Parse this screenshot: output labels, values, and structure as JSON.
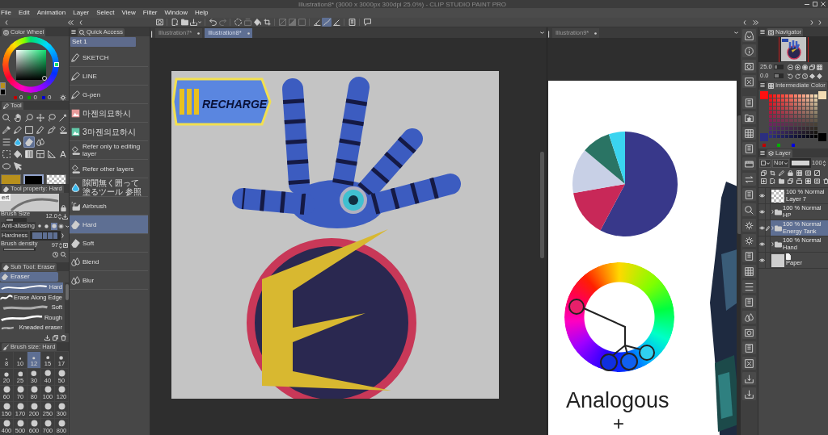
{
  "window": {
    "title": "Illustration8* (3000 x 3000px 300dpi 25.0%) - CLIP STUDIO PAINT PRO"
  },
  "menu": [
    "File",
    "Edit",
    "Animation",
    "Layer",
    "Select",
    "View",
    "Filter",
    "Window",
    "Help"
  ],
  "command_bar": [
    {
      "on": false,
      "disabled": false
    },
    {
      "on": false,
      "disabled": false
    },
    {
      "on": false,
      "disabled": false
    },
    {
      "on": false,
      "disabled": false
    },
    {
      "on": false,
      "disabled": false
    },
    {
      "on": false,
      "disabled": true
    },
    {
      "on": false,
      "disabled": false
    },
    {
      "on": false,
      "disabled": true
    },
    {
      "on": false,
      "disabled": false
    },
    {
      "on": false,
      "disabled": false
    },
    {
      "on": false,
      "disabled": true
    },
    {
      "on": false,
      "disabled": true
    },
    {
      "on": false,
      "disabled": true
    },
    {
      "on": false,
      "disabled": false
    },
    {
      "on": true,
      "disabled": false
    },
    {
      "on": false,
      "disabled": false
    },
    {
      "on": false,
      "disabled": false
    },
    {
      "on": false,
      "disabled": false
    }
  ],
  "color_wheel": {
    "title": "Color Wheel",
    "colors": [
      {
        "color": "#b8901c"
      },
      {
        "color": "#000000"
      }
    ],
    "channels": [
      {
        "color": "#c00000",
        "value": "0"
      },
      {
        "color": "#00a000",
        "value": "0"
      },
      {
        "color": "#0000d0",
        "value": "0"
      }
    ]
  },
  "tool_panel": {
    "title": "Tool",
    "tool_rows": [
      [
        {
          "selected": false
        },
        {
          "selected": false
        },
        {
          "selected": false
        },
        {
          "selected": false
        },
        {
          "selected": false
        },
        {
          "selected": false
        }
      ],
      [
        {
          "selected": false
        },
        {
          "selected": false
        },
        {
          "selected": false
        },
        {
          "selected": false
        },
        {
          "selected": false
        },
        {
          "selected": false
        }
      ],
      [
        {
          "selected": false
        },
        {
          "selected": false
        },
        {
          "selected": true
        },
        {
          "selected": false
        }
      ],
      [
        {
          "selected": false
        },
        {
          "selected": false
        },
        {
          "selected": false
        },
        {
          "selected": false
        },
        {
          "selected": false
        },
        {
          "glyph": "A",
          "selected": false
        }
      ],
      [
        {
          "selected": false
        },
        {
          "selected": false
        }
      ]
    ],
    "colors": [
      {
        "kind": "solid",
        "color": "#b8901c",
        "selected": false
      },
      {
        "kind": "solid",
        "color": "#000000",
        "selected": true
      },
      {
        "kind": "transparent",
        "selected": false
      }
    ]
  },
  "tool_property": {
    "title": "Tool property: Hard",
    "preview_label": "ert",
    "brush_size": {
      "label": "Brush Size",
      "value": "12.0",
      "level": 0.35
    },
    "anti_aliasing": {
      "label": "Anti-aliasing",
      "options": [
        {
          "selected": false
        },
        {
          "selected": false
        },
        {
          "selected": true
        },
        {
          "selected": false
        }
      ]
    },
    "hardness": {
      "label": "Hardness",
      "level": 1
    },
    "brush_density": {
      "label": "Brush density",
      "value": "97",
      "level": 0.97
    }
  },
  "sub_tool": {
    "title": "Sub Tool: Eraser",
    "group": {
      "label": "Eraser",
      "selected": true
    },
    "items": [
      {
        "label": "Hard",
        "selected": true
      },
      {
        "label": "Erase Along Edge",
        "selected": false
      },
      {
        "label": "Soft",
        "selected": false
      },
      {
        "label": "Rough",
        "selected": false
      },
      {
        "label": "Kneaded eraser",
        "selected": false
      }
    ]
  },
  "brush_size_panel": {
    "title": "Brush size: Hard",
    "sizes": [
      {
        "label": "8",
        "selected": false
      },
      {
        "label": "10",
        "selected": false
      },
      {
        "label": "12",
        "selected": true
      },
      {
        "label": "15",
        "selected": false
      },
      {
        "label": "17",
        "selected": false
      },
      {
        "label": "20",
        "selected": false
      },
      {
        "label": "25",
        "selected": false
      },
      {
        "label": "30",
        "selected": false
      },
      {
        "label": "40",
        "selected": false
      },
      {
        "label": "50",
        "selected": false
      },
      {
        "label": "60",
        "selected": false
      },
      {
        "label": "70",
        "selected": false
      },
      {
        "label": "80",
        "selected": false
      },
      {
        "label": "100",
        "selected": false
      },
      {
        "label": "120",
        "selected": false
      },
      {
        "label": "150",
        "selected": false
      },
      {
        "label": "170",
        "selected": false
      },
      {
        "label": "200",
        "selected": false
      },
      {
        "label": "250",
        "selected": false
      },
      {
        "label": "300",
        "selected": false
      },
      {
        "label": "400",
        "selected": false
      },
      {
        "label": "500",
        "selected": false
      },
      {
        "label": "600",
        "selected": false
      },
      {
        "label": "700",
        "selected": false
      },
      {
        "label": "800",
        "selected": false
      }
    ]
  },
  "quick_access": {
    "title": "Quick Access",
    "set": "Set 1",
    "items": [
      {
        "label": "SKETCH",
        "selected": false
      },
      {
        "label": "LINE",
        "selected": false
      },
      {
        "label": "G-pen",
        "selected": false
      },
      {
        "label": "마젠의묘하시",
        "selected": false
      },
      {
        "label": "3마젠의묘하시",
        "selected": false
      },
      {
        "label": "Refer only to editing layer",
        "selected": false
      },
      {
        "label": "Refer other layers",
        "selected": false
      },
      {
        "label": "隙間無く囲って塗るツール 参照",
        "selected": false
      },
      {
        "label": "Airbrush",
        "selected": false
      },
      {
        "label": "Hard",
        "selected": true
      },
      {
        "label": "Soft",
        "selected": false
      },
      {
        "label": "Blend",
        "selected": false
      },
      {
        "label": "Blur",
        "selected": false
      }
    ]
  },
  "canvases": [
    {
      "tabs": [
        {
          "label": "Illustration7*",
          "selected": false
        },
        {
          "label": "Illustration8*",
          "selected": true
        }
      ],
      "logo_text": "RECHARGE"
    },
    {
      "tabs": [
        {
          "label": "Illustration9*",
          "selected": false
        }
      ],
      "texts": [
        "Analogous",
        "+"
      ]
    }
  ],
  "navigator": {
    "title": "Navigator",
    "zoom": "25.0",
    "zoom_slider": {
      "level": 0.25
    },
    "rotation": "0.0",
    "rotation_slider": {
      "level": 0.5
    }
  },
  "intermediate_color": {
    "title": "Intermediate Color",
    "corners": [
      {
        "color": "#ff1010"
      },
      {
        "color": "#f2dcb4"
      },
      {
        "color": "#2c2f80"
      },
      {
        "color": "#000000"
      }
    ],
    "channels": [
      {
        "color": "#c00000"
      },
      {
        "color": "#00b000"
      },
      {
        "color": "#0000e0"
      }
    ]
  },
  "layer_panel": {
    "title": "Layer",
    "blend_mode": "Nor",
    "opacity": "100",
    "opacity_slider": {
      "level": 1
    },
    "layers": [
      {
        "name": "Layer 7",
        "mode": "100 % Normal",
        "kind": "raster",
        "visible": true,
        "selected": false
      },
      {
        "name": "HP",
        "mode": "100 % Normal",
        "kind": "folder",
        "visible": true,
        "selected": false,
        "expanded": false
      },
      {
        "name": "Energy Tank",
        "mode": "100 % Normal",
        "kind": "folder",
        "visible": true,
        "selected": true,
        "expanded": false
      },
      {
        "name": "Hand",
        "mode": "100 % Normal",
        "kind": "folder",
        "visible": true,
        "selected": false,
        "expanded": false
      },
      {
        "name": "Paper",
        "kind": "paper",
        "visible": true,
        "selected": false
      }
    ]
  }
}
